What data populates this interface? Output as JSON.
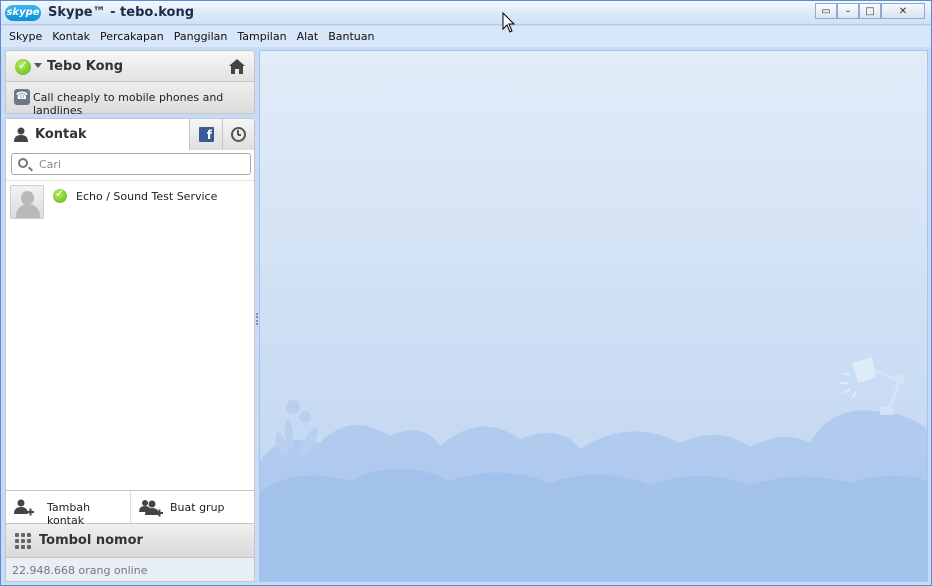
{
  "window": {
    "logo_text": "skype",
    "title": "Skype™ - tebo.kong",
    "controls": {
      "restore": "▭",
      "minimize": "–",
      "maximize": "□",
      "close": "✕"
    }
  },
  "menu": [
    "Skype",
    "Kontak",
    "Percakapan",
    "Panggilan",
    "Tampilan",
    "Alat",
    "Bantuan"
  ],
  "profile": {
    "name": "Tebo Kong",
    "status": "online",
    "status_color": "#5cb315"
  },
  "promo": {
    "text": "Call cheaply to mobile phones and landlines"
  },
  "tabs": {
    "contacts_label": "Kontak"
  },
  "search": {
    "placeholder": "Cari",
    "value": ""
  },
  "contacts": [
    {
      "name": "Echo / Sound Test Service",
      "status": "online"
    }
  ],
  "actions": {
    "add_contact": "Tambah kontak",
    "create_group": "Buat grup"
  },
  "dialpad": {
    "label": "Tombol nomor"
  },
  "footer": {
    "online_count": "22.948.668 orang online"
  },
  "colors": {
    "titlebar": "#dbe8f8",
    "main_bg_top": "#e2ecf8",
    "main_bg_bottom": "#bcd3f0",
    "facebook": "#3b5998"
  }
}
